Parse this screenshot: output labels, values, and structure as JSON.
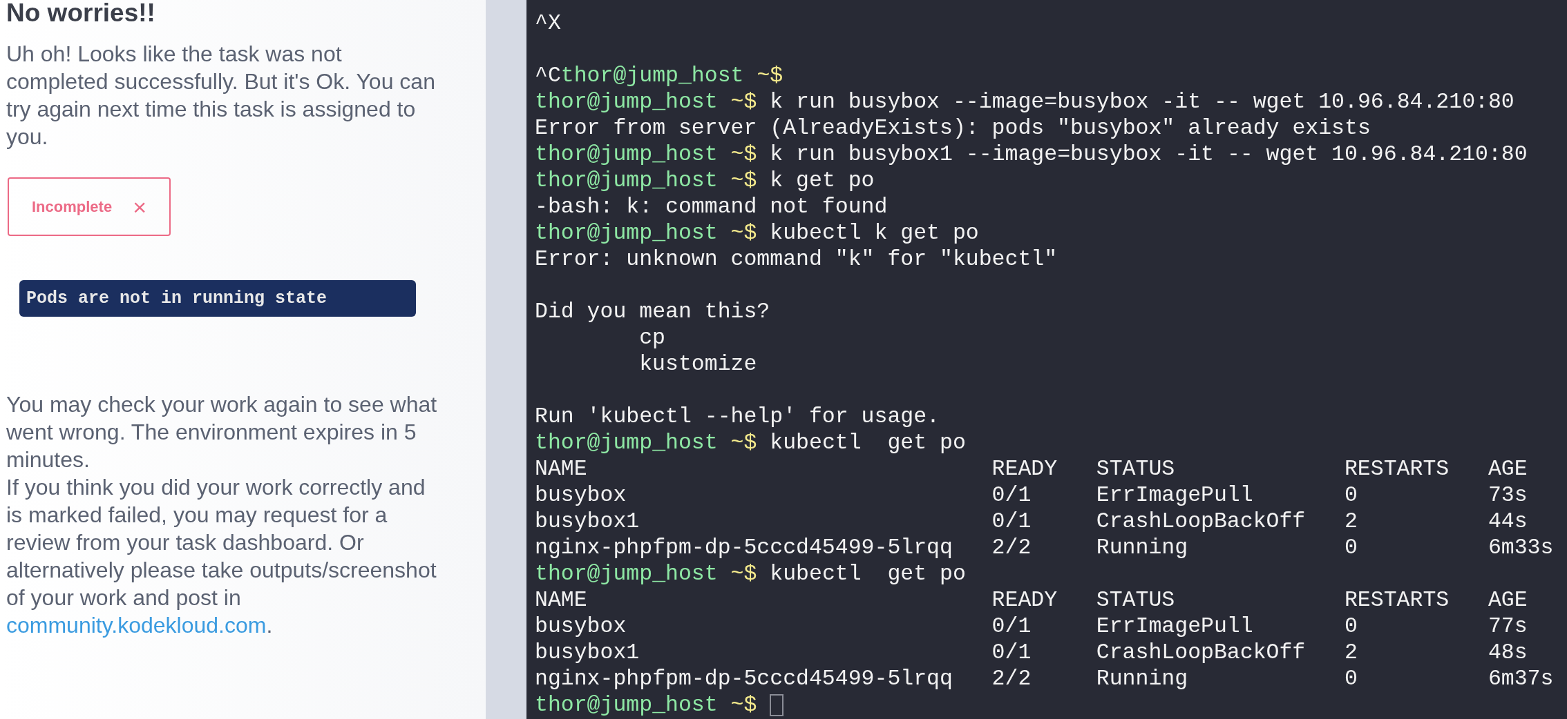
{
  "result": {
    "heading": "No worries!!",
    "message": "Uh oh! Looks like the task was not completed successfully. But it's Ok. You can try again next time this task is assigned to you.",
    "status": {
      "label": "Incomplete",
      "icon": "×"
    },
    "check_message": "Pods are not in running state",
    "notes": [
      {
        "text": "You may check your work again to see what went wrong. The environment expires in 5 minutes."
      },
      {
        "text": "If you think you did your work correctly and is marked failed, you may request for a review from your task dashboard. Or alternatively please take outputs/screenshot of your work and post in ",
        "link": "community.kodekloud.com",
        "after": "."
      }
    ]
  },
  "terminal": {
    "lines": [
      {
        "kind": "output",
        "text": "^X"
      },
      {
        "kind": "blank"
      },
      {
        "kind": "prompt",
        "prefix": "^C",
        "user": "thor@jump_host",
        "symbol": "~$"
      },
      {
        "kind": "prompt",
        "user": "thor@jump_host",
        "symbol": "~$",
        "command": "k run busybox --image=busybox -it -- wget 10.96.84.210:80"
      },
      {
        "kind": "output",
        "text": "Error from server (AlreadyExists): pods \"busybox\" already exists"
      },
      {
        "kind": "prompt",
        "user": "thor@jump_host",
        "symbol": "~$",
        "command": "k run busybox1 --image=busybox -it -- wget 10.96.84.210:80"
      },
      {
        "kind": "prompt",
        "user": "thor@jump_host",
        "symbol": "~$",
        "command": "k get po"
      },
      {
        "kind": "output",
        "text": "-bash: k: command not found"
      },
      {
        "kind": "prompt",
        "user": "thor@jump_host",
        "symbol": "~$",
        "command": "kubectl k get po"
      },
      {
        "kind": "output",
        "text": "Error: unknown command \"k\" for \"kubectl\""
      },
      {
        "kind": "blank"
      },
      {
        "kind": "output",
        "text": "Did you mean this?"
      },
      {
        "kind": "suggestion",
        "text": "cp"
      },
      {
        "kind": "suggestion",
        "text": "kustomize"
      },
      {
        "kind": "blank"
      },
      {
        "kind": "output",
        "text": "Run 'kubectl --help' for usage."
      },
      {
        "kind": "prompt",
        "user": "thor@jump_host",
        "symbol": "~$",
        "command": "kubectl  get po"
      },
      {
        "kind": "table_row",
        "cells": [
          "NAME",
          "READY",
          "STATUS",
          "RESTARTS",
          "AGE"
        ]
      },
      {
        "kind": "table_row",
        "cells": [
          "busybox",
          "0/1",
          "ErrImagePull",
          "0",
          "73s"
        ]
      },
      {
        "kind": "table_row",
        "cells": [
          "busybox1",
          "0/1",
          "CrashLoopBackOff",
          "2",
          "44s"
        ]
      },
      {
        "kind": "table_row",
        "cells": [
          "nginx-phpfpm-dp-5cccd45499-5lrqq",
          "2/2",
          "Running",
          "0",
          "6m33s"
        ]
      },
      {
        "kind": "prompt",
        "user": "thor@jump_host",
        "symbol": "~$",
        "command": "kubectl  get po"
      },
      {
        "kind": "table_row",
        "cells": [
          "NAME",
          "READY",
          "STATUS",
          "RESTARTS",
          "AGE"
        ]
      },
      {
        "kind": "table_row",
        "cells": [
          "busybox",
          "0/1",
          "ErrImagePull",
          "0",
          "77s"
        ]
      },
      {
        "kind": "table_row",
        "cells": [
          "busybox1",
          "0/1",
          "CrashLoopBackOff",
          "2",
          "48s"
        ]
      },
      {
        "kind": "table_row",
        "cells": [
          "nginx-phpfpm-dp-5cccd45499-5lrqq",
          "2/2",
          "Running",
          "0",
          "6m37s"
        ]
      },
      {
        "kind": "prompt",
        "user": "thor@jump_host",
        "symbol": "~$",
        "cursor": true
      }
    ]
  }
}
